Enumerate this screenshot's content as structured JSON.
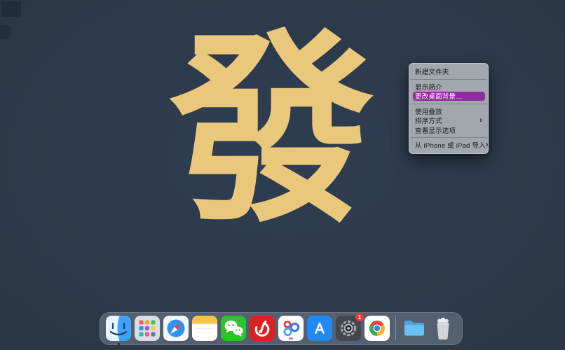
{
  "colors": {
    "desktop_background": "#2C3A4B",
    "wallpaper_char_color": "#E9C87C",
    "menu_background": "#A8ACB2",
    "menu_highlight": "#8F2B9E",
    "badge_red": "#EE3B30"
  },
  "desktop": {
    "wallpaper_character": "發"
  },
  "context_menu": {
    "items": [
      {
        "label": "新建文件夹",
        "submenu": false,
        "highlighted": false
      },
      {
        "label": "显示简介",
        "submenu": false,
        "highlighted": false
      },
      {
        "label": "更改桌面背景…",
        "submenu": false,
        "highlighted": true
      },
      {
        "label": "使用叠放",
        "submenu": false,
        "highlighted": false
      },
      {
        "label": "排序方式",
        "submenu": true,
        "highlighted": false
      },
      {
        "label": "查看显示选项",
        "submenu": false,
        "highlighted": false
      },
      {
        "label": "从 iPhone 或 iPad 导入",
        "submenu": true,
        "highlighted": false
      }
    ]
  },
  "dock": {
    "apps": [
      {
        "name": "finder",
        "running": true
      },
      {
        "name": "launchpad"
      },
      {
        "name": "safari"
      },
      {
        "name": "notes"
      },
      {
        "name": "wechat"
      },
      {
        "name": "netease-music"
      },
      {
        "name": "baidu-netdisk"
      },
      {
        "name": "app-store"
      },
      {
        "name": "system-settings",
        "badge": "1"
      },
      {
        "name": "chrome"
      },
      {
        "name": "downloads-folder"
      },
      {
        "name": "trash"
      }
    ]
  }
}
